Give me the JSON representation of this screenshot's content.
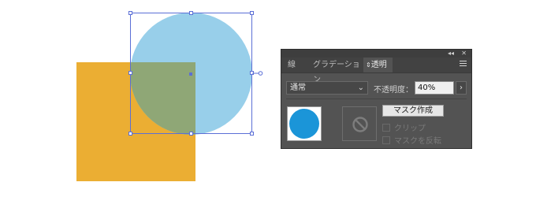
{
  "canvas": {
    "colors": {
      "orange": "#EBAE33",
      "blue": "#98CFEA",
      "overlap": "#8FA776",
      "selection": "#5B6FD6"
    }
  },
  "panel": {
    "top_buttons": [
      "◂◂",
      "✕"
    ],
    "tabs": [
      {
        "label": "線"
      },
      {
        "label": "グラデーション"
      },
      {
        "label": "透明",
        "icon": "sort-arrows-icon",
        "active": true
      }
    ],
    "menu_icon": "hamburger-icon",
    "blend_mode": {
      "value": "通常"
    },
    "opacity": {
      "label": "不透明度：",
      "value": "40%",
      "arrow": "›"
    },
    "thumbnail": {
      "fill": "#1B95D8",
      "icon": "circle-object-thumbnail"
    },
    "mask_thumbnail_icon": "no-mask-icon",
    "make_mask_button": "マスク作成",
    "clip_label": "クリップ",
    "invert_mask_label": "マスクを反転"
  }
}
